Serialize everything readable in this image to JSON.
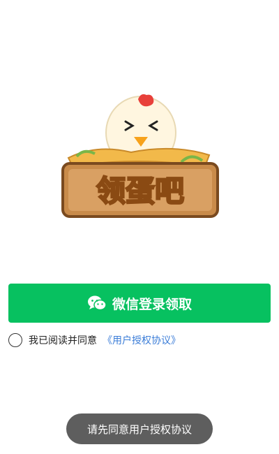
{
  "logo": {
    "text": "领蛋吧",
    "icon": "chicken-nest-icon"
  },
  "login": {
    "button_label": "微信登录领取",
    "icon": "wechat-icon",
    "color": "#07c160"
  },
  "agreement": {
    "text": "我已阅读并同意",
    "link_label": "《用户授权协议》",
    "link_color": "#3b7dd8",
    "checked": false
  },
  "toast": {
    "message": "请先同意用户授权协议"
  }
}
